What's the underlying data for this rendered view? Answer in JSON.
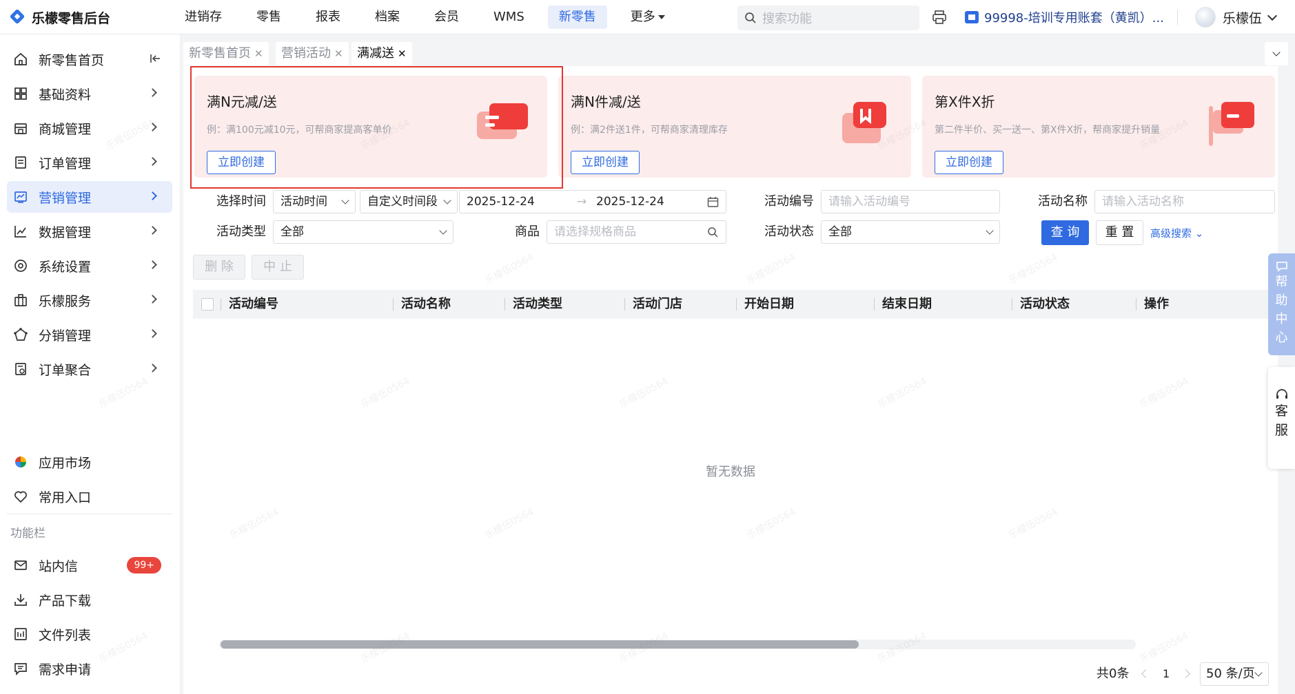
{
  "app": {
    "brand": "乐檬零售后台"
  },
  "topnav": {
    "items": [
      "进销存",
      "零售",
      "报表",
      "档案",
      "会员",
      "WMS",
      "新零售",
      "更多"
    ],
    "active_index": 6,
    "search_placeholder": "搜索功能",
    "account": "99998-培训专用账套（黄凯）...",
    "user": "乐檬伍"
  },
  "sidebar": {
    "items": [
      {
        "label": "新零售首页",
        "icon": "home-icon"
      },
      {
        "label": "基础资料",
        "icon": "grid-icon"
      },
      {
        "label": "商城管理",
        "icon": "shop-icon"
      },
      {
        "label": "订单管理",
        "icon": "order-icon"
      },
      {
        "label": "营销管理",
        "icon": "marketing-icon",
        "active": true
      },
      {
        "label": "数据管理",
        "icon": "chart-line-icon"
      },
      {
        "label": "系统设置",
        "icon": "settings-icon"
      },
      {
        "label": "乐檬服务",
        "icon": "briefcase-icon"
      },
      {
        "label": "分销管理",
        "icon": "distribution-icon"
      },
      {
        "label": "订单聚合",
        "icon": "aggregate-icon"
      }
    ],
    "extra": [
      {
        "label": "应用市场",
        "icon": "app-market-icon"
      },
      {
        "label": "常用入口",
        "icon": "heart-icon"
      }
    ],
    "section_title": "功能栏",
    "tools": [
      {
        "label": "站内信",
        "icon": "mail-icon",
        "badge": "99+"
      },
      {
        "label": "产品下载",
        "icon": "download-icon"
      },
      {
        "label": "文件列表",
        "icon": "file-list-icon"
      },
      {
        "label": "需求申请",
        "icon": "request-icon"
      }
    ]
  },
  "tabs": [
    {
      "label": "新零售首页",
      "active": false
    },
    {
      "label": "营销活动",
      "active": false
    },
    {
      "label": "满减送",
      "active": true
    }
  ],
  "cards": [
    {
      "title": "满N元减/送",
      "desc": "例：满100元减10元，可帮商家提高客单价",
      "button": "立即创建",
      "art": "coupon-icon"
    },
    {
      "title": "满N件减/送",
      "desc": "例：满2件送1件，可帮商家清理库存",
      "button": "立即创建",
      "art": "gift-box-icon"
    },
    {
      "title": "第X件X折",
      "desc": "第二件半价、买一送一、第X件X折，帮商家提升销量",
      "button": "立即创建",
      "art": "flag-icon"
    }
  ],
  "filters": {
    "time_label": "选择时间",
    "time_type": "活动时间",
    "time_range": "自定义时间段",
    "date_start": "2025-12-24",
    "date_arrow": "→",
    "date_end": "2025-12-24",
    "code_label": "活动编号",
    "code_placeholder": "请输入活动编号",
    "name_label": "活动名称",
    "name_placeholder": "请输入活动名称",
    "type_label": "活动类型",
    "type_value": "全部",
    "goods_label": "商品",
    "goods_placeholder": "请选择规格商品",
    "status_label": "活动状态",
    "status_value": "全部",
    "query": "查 询",
    "reset": "重 置",
    "advanced": "高级搜索"
  },
  "actions": {
    "delete": "删 除",
    "stop": "中 止"
  },
  "table": {
    "columns": [
      "活动编号",
      "活动名称",
      "活动类型",
      "活动门店",
      "开始日期",
      "结束日期",
      "活动状态",
      "操作"
    ],
    "empty": "暂无数据"
  },
  "pagination": {
    "total": "共0条",
    "page": "1",
    "page_size": "50 条/页"
  },
  "float": {
    "help": [
      "帮",
      "助",
      "中",
      "心"
    ],
    "service": [
      "客",
      "服"
    ]
  },
  "watermark": "乐檬伍0564",
  "colors": {
    "accent": "#2f6ae0",
    "highlight": "#e2372f",
    "card_bg": "#fdecec",
    "badge": "#e8453c"
  }
}
